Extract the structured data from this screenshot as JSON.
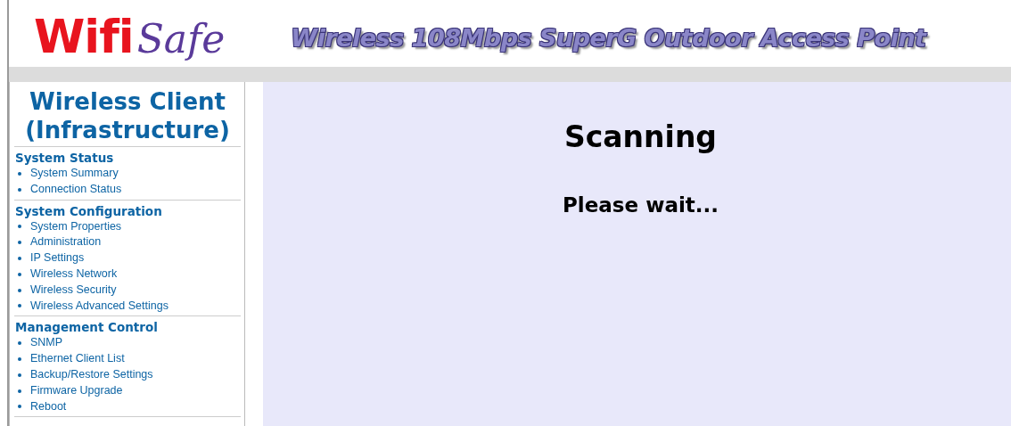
{
  "header": {
    "logo": {
      "part_1": "Wifi",
      "part_2": "Safe"
    },
    "title": "Wireless 108Mbps SuperG Outdoor Access Point"
  },
  "sidebar": {
    "title": "Wireless Client (Infrastructure)",
    "sections": [
      {
        "heading": "System Status",
        "items": [
          "System Summary",
          "Connection Status"
        ]
      },
      {
        "heading": "System Configuration",
        "items": [
          "System Properties",
          "Administration",
          "IP Settings",
          "Wireless Network",
          "Wireless Security",
          "Wireless Advanced Settings"
        ]
      },
      {
        "heading": "Management Control",
        "items": [
          "SNMP",
          "Ethernet Client List",
          "Backup/Restore Settings",
          "Firmware Upgrade",
          "Reboot"
        ]
      }
    ]
  },
  "main": {
    "heading": "Scanning",
    "message": "Please wait..."
  }
}
